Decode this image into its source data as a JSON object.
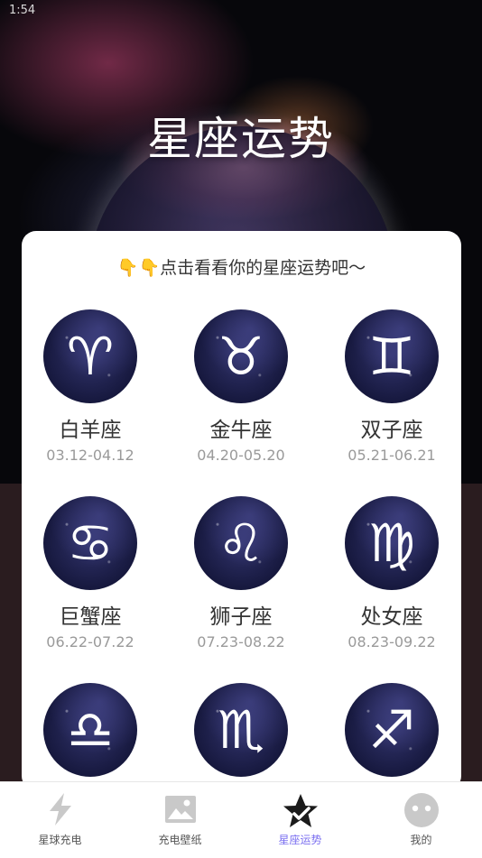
{
  "status_bar": {
    "time": "1:54"
  },
  "header": {
    "title": "星座运势"
  },
  "card": {
    "prompt": "👇👇点击看看你的星座运势吧～",
    "signs": [
      {
        "symbol": "♈",
        "name": "白羊座",
        "dates": "03.12-04.12"
      },
      {
        "symbol": "♉",
        "name": "金牛座",
        "dates": "04.20-05.20"
      },
      {
        "symbol": "♊",
        "name": "双子座",
        "dates": "05.21-06.21"
      },
      {
        "symbol": "♋",
        "name": "巨蟹座",
        "dates": "06.22-07.22"
      },
      {
        "symbol": "♌",
        "name": "狮子座",
        "dates": "07.23-08.22"
      },
      {
        "symbol": "♍",
        "name": "处女座",
        "dates": "08.23-09.22"
      },
      {
        "symbol": "♎"
      },
      {
        "symbol": "♏"
      },
      {
        "symbol": "♐"
      }
    ]
  },
  "tabbar": {
    "active_color": "#7b6ff0",
    "items": [
      {
        "label": "星球充电",
        "icon": "lightning-icon"
      },
      {
        "label": "充电壁纸",
        "icon": "image-icon"
      },
      {
        "label": "星座运势",
        "icon": "star-icon",
        "active": true
      },
      {
        "label": "我的",
        "icon": "profile-face-icon"
      }
    ]
  }
}
